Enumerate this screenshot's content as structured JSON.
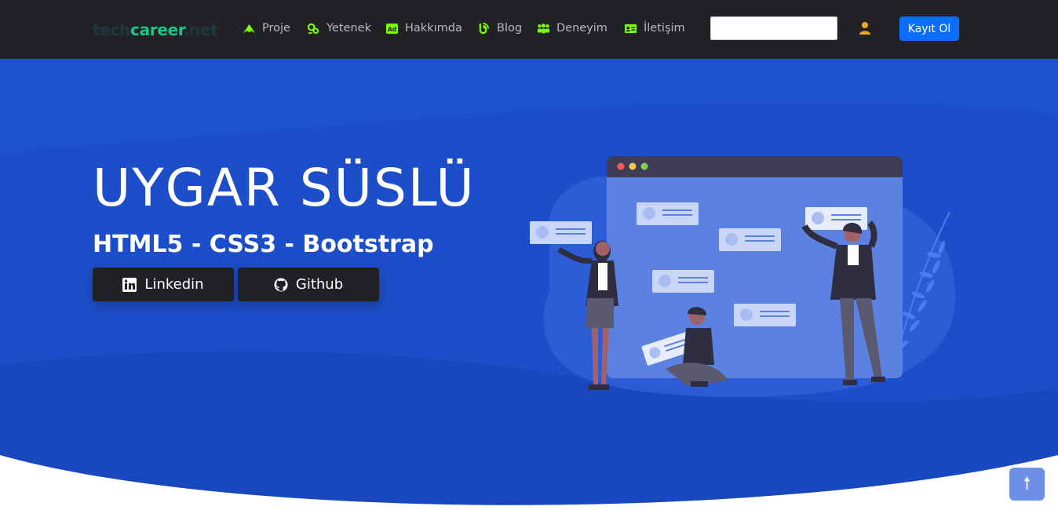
{
  "brand": {
    "part1": "tech",
    "part2": "career",
    "part3": ".net"
  },
  "nav": {
    "items": [
      {
        "label": "Proje",
        "icon": "pen-nib-icon"
      },
      {
        "label": "Yetenek",
        "icon": "gear-tree-icon"
      },
      {
        "label": "Hakkımda",
        "icon": "ad-badge-icon"
      },
      {
        "label": "Blog",
        "icon": "blog-icon"
      },
      {
        "label": "Deneyim",
        "icon": "users-icon"
      },
      {
        "label": "İletişim",
        "icon": "address-card-icon"
      }
    ],
    "search": {
      "value": "",
      "placeholder": ""
    },
    "user_icon": "user-icon",
    "signup_label": "Kayıt Ol"
  },
  "hero": {
    "name": "UYGAR SÜSLÜ",
    "subtitle": "HTML5 - CSS3 - Bootstrap",
    "buttons": [
      {
        "label": "Linkedin",
        "icon": "linkedin-icon"
      },
      {
        "label": "Github",
        "icon": "github-icon"
      }
    ]
  },
  "back_to_top": {
    "icon": "arrow-up-icon",
    "glyph": "🠕"
  },
  "colors": {
    "navbar_bg": "#212225",
    "nav_icon_green": "#7cfc00",
    "nav_text": "#b7b9bd",
    "hero_blue": "#1d4ec9",
    "hero_blue_dark": "#1a47bd",
    "button_dark": "#1f2125",
    "signup_blue": "#0d6efd",
    "user_icon_orange": "#f5a623",
    "brand_green": "#1ec58a"
  }
}
